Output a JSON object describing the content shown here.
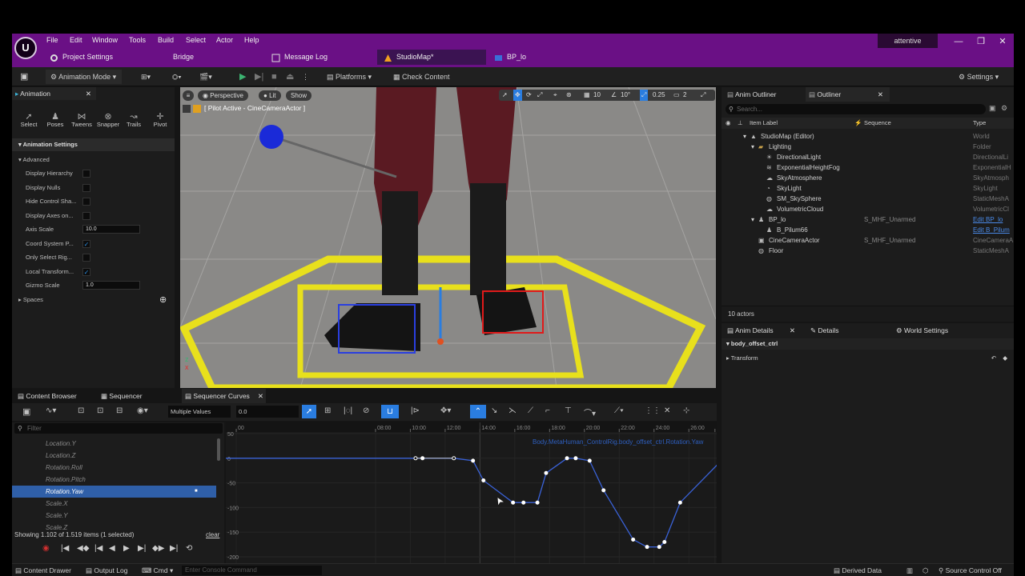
{
  "titlebar": {
    "logo": "U",
    "menus": [
      "File",
      "Edit",
      "Window",
      "Tools",
      "Build",
      "Select",
      "Actor",
      "Help"
    ],
    "project_name": "attentive",
    "tabs": [
      {
        "label": "Project Settings",
        "icon": "gear-icon"
      },
      {
        "label": "Bridge",
        "icon": "bridge-icon"
      },
      {
        "label": "Message Log",
        "icon": "log-icon"
      },
      {
        "label": "StudioMap*",
        "icon": "map-icon",
        "active": true
      },
      {
        "label": "BP_lo",
        "icon": "blueprint-icon"
      }
    ],
    "window_buttons": [
      "—",
      "❐",
      "✕"
    ]
  },
  "toolbar": {
    "mode": "Animation Mode",
    "platforms": "Platforms",
    "check_content": "Check Content",
    "settings": "Settings"
  },
  "animation_panel": {
    "tab": "Animation",
    "tools": [
      "Select",
      "Poses",
      "Tweens",
      "Snapper",
      "Trails",
      "Pivot"
    ],
    "section": "Animation Settings",
    "subsection": "Advanced",
    "rows": [
      {
        "label": "Display Hierarchy",
        "type": "check",
        "checked": false
      },
      {
        "label": "Display Nulls",
        "type": "check",
        "checked": false
      },
      {
        "label": "Hide Control Sha...",
        "type": "check",
        "checked": false
      },
      {
        "label": "Display Axes on...",
        "type": "check",
        "checked": false
      },
      {
        "label": "Axis Scale",
        "type": "num",
        "value": "10.0"
      },
      {
        "label": "Coord System P...",
        "type": "check",
        "checked": true
      },
      {
        "label": "Only Select Rig...",
        "type": "check",
        "checked": false
      },
      {
        "label": "Local Transform...",
        "type": "check",
        "checked": true
      },
      {
        "label": "Gizmo Scale",
        "type": "num",
        "value": "1.0"
      }
    ],
    "spaces": "Spaces"
  },
  "viewport": {
    "perspective": "Perspective",
    "lit": "Lit",
    "show": "Show",
    "pilot": "[ Pilot Active - CineCameraActor ]",
    "grid": "10",
    "angle": "10°",
    "scale": "0.25",
    "cams": "2"
  },
  "outliner": {
    "tabs": [
      "Anim Outliner",
      "Outliner"
    ],
    "search_placeholder": "Search...",
    "columns": [
      "Item Label",
      "Sequence",
      "Type"
    ],
    "rows": [
      {
        "label": "StudioMap (Editor)",
        "seq": "",
        "type": "World",
        "indent": 1,
        "icon": "world-icon"
      },
      {
        "label": "Lighting",
        "seq": "",
        "type": "Folder",
        "indent": 2,
        "icon": "folder-icon"
      },
      {
        "label": "DirectionalLight",
        "seq": "",
        "type": "DirectionalLi",
        "indent": 3,
        "icon": "light-icon"
      },
      {
        "label": "ExponentialHeightFog",
        "seq": "",
        "type": "ExponentialH",
        "indent": 3,
        "icon": "fog-icon"
      },
      {
        "label": "SkyAtmosphere",
        "seq": "",
        "type": "SkyAtmosph",
        "indent": 3,
        "icon": "sky-icon"
      },
      {
        "label": "SkyLight",
        "seq": "",
        "type": "SkyLight",
        "indent": 3,
        "icon": "skylight-icon"
      },
      {
        "label": "SM_SkySphere",
        "seq": "",
        "type": "StaticMeshA",
        "indent": 3,
        "icon": "mesh-icon"
      },
      {
        "label": "VolumetricCloud",
        "seq": "",
        "type": "VolumetricCl",
        "indent": 3,
        "icon": "cloud-icon"
      },
      {
        "label": "BP_lo",
        "seq": "S_MHF_Unarmed",
        "type": "Edit BP_lo",
        "indent": 2,
        "icon": "actor-icon",
        "link": true
      },
      {
        "label": "B_Pilum66",
        "seq": "",
        "type": "Edit B_Pilum",
        "indent": 3,
        "icon": "actor-icon",
        "link": true
      },
      {
        "label": "CineCameraActor",
        "seq": "S_MHF_Unarmed",
        "type": "CineCameraA",
        "indent": 2,
        "icon": "camera-icon"
      },
      {
        "label": "Floor",
        "seq": "",
        "type": "StaticMeshA",
        "indent": 2,
        "icon": "mesh-icon"
      }
    ],
    "count": "10 actors"
  },
  "details": {
    "tabs": [
      "Anim Details",
      "Details",
      "World Settings"
    ],
    "object": "body_offset_ctrl",
    "transform": "Transform"
  },
  "bottom_tabs": [
    "Content Browser",
    "Sequencer",
    "Sequencer Curves"
  ],
  "curves": {
    "value_mode": "Multiple Values",
    "value": "0.0",
    "filter_placeholder": "Filter",
    "items": [
      "Location.Y",
      "Location.Z",
      "Rotation.Roll",
      "Rotation.Pitch",
      "Rotation.Yaw",
      "Scale.X",
      "Scale.Y",
      "Scale.Z"
    ],
    "selected": "Rotation.Yaw",
    "status": "Showing 1.102 of 1.519 items (1 selected)",
    "clear": "clear",
    "ruler": [
      "00",
      "08:00",
      "10:00",
      "12:00",
      "14:00",
      "16:00",
      "18:00",
      "20:00",
      "22:00",
      "24:00",
      "26:00",
      "2"
    ],
    "curve_name": "Body.MetaHuman_ControlRig.body_offset_ctrl.Rotation.Yaw",
    "y_ticks": [
      "50",
      "0",
      "-50",
      "-100",
      "-150",
      "-200"
    ]
  },
  "chart_data": {
    "type": "line",
    "title": "Body.MetaHuman_ControlRig.body_offset_ctrl.Rotation.Yaw",
    "ylim": [
      -200,
      50
    ],
    "x": [
      -2,
      4.5,
      10.3,
      10.7,
      12.5,
      13.6,
      14.2,
      15.9,
      16.5,
      17.3,
      17.8,
      19.0,
      19.5,
      20.3,
      21.1,
      22.8,
      23.6,
      24.3,
      24.6,
      25.5,
      28
    ],
    "y": [
      0,
      0,
      0,
      0,
      0,
      -5,
      -45,
      -90,
      -90,
      -90,
      -30,
      0,
      0,
      -5,
      -65,
      -165,
      -180,
      -180,
      -170,
      -90,
      0
    ]
  },
  "statusbar": {
    "content_drawer": "Content Drawer",
    "output_log": "Output Log",
    "cmd": "Cmd",
    "console_placeholder": "Enter Console Command",
    "derived_data": "Derived Data",
    "source_control": "Source Control Off"
  }
}
